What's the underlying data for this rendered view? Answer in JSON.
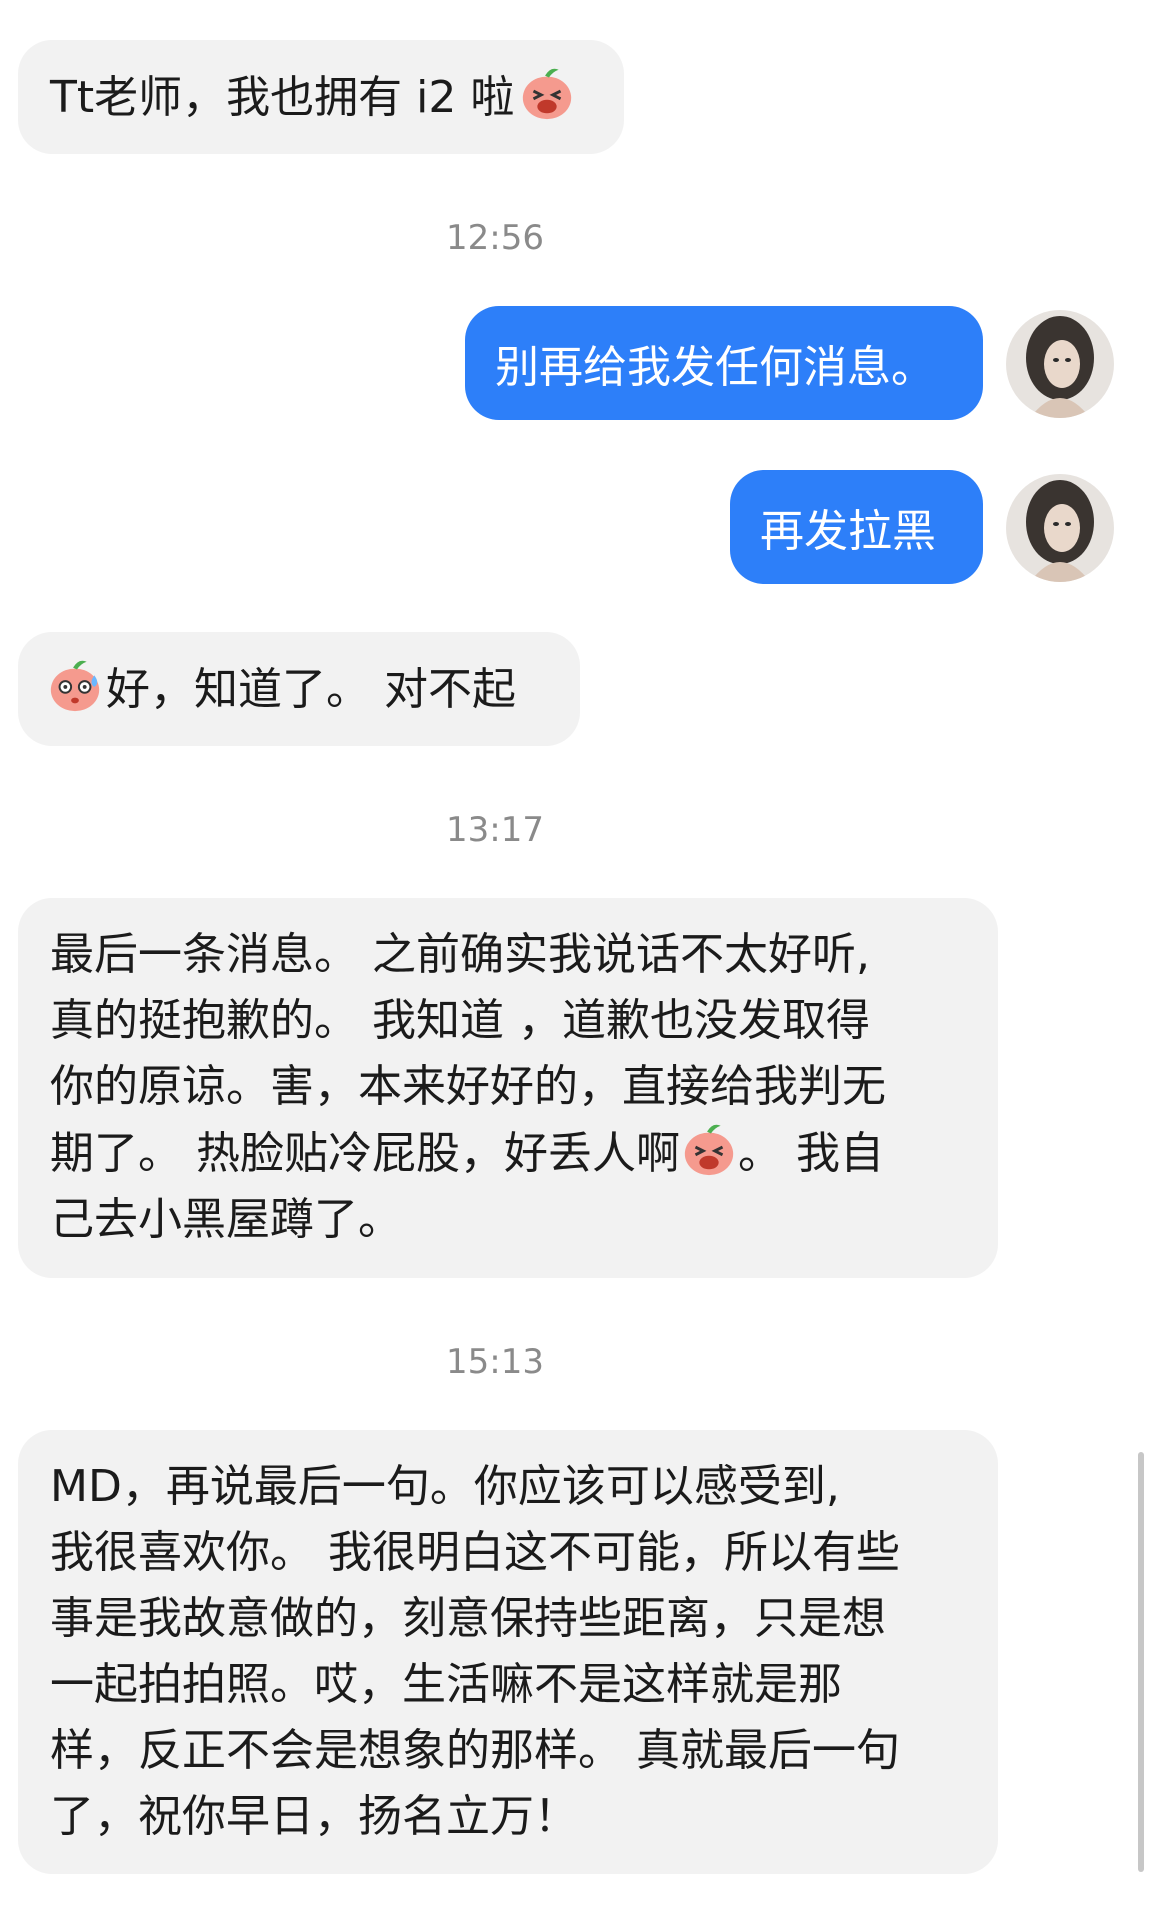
{
  "messages": [
    {
      "type": "in",
      "text": "Tt老师，我也拥有 i2 啦",
      "emoji_after": "grinning-peach-emoji"
    },
    {
      "type": "time",
      "text": "12:56"
    },
    {
      "type": "out",
      "text": "别再给我发任何消息。"
    },
    {
      "type": "out",
      "text": "再发拉黑"
    },
    {
      "type": "in",
      "text": "好，知道了。 对不起",
      "emoji_before": "sweating-peach-emoji"
    },
    {
      "type": "time",
      "text": "13:17"
    },
    {
      "type": "in",
      "lines": [
        "最后一条消息。 之前确实我说话不太好听,",
        "真的挺抱歉的。 我知道 ，道歉也没发取得",
        "你的原谅。害，本来好好的，直接给我判无",
        "期了。 热脸贴冷屁股，好丢人啊",
        "己去小黑屋蹲了。"
      ],
      "line4_tail": "。 我自",
      "emoji_inline": "grinning-peach-emoji"
    },
    {
      "type": "time",
      "text": "15:13"
    },
    {
      "type": "in",
      "lines": [
        "MD，再说最后一句。你应该可以感受到,",
        "我很喜欢你。 我很明白这不可能，所以有些",
        "事是我故意做的，刻意保持些距离，只是想",
        "一起拍拍照。哎，生活嘛不是这样就是那",
        "样，反正不会是想象的那样。 真就最后一句",
        "了，祝你早日，扬名立万！"
      ]
    }
  ],
  "colors": {
    "outgoing_bubble": "#2d7ff9",
    "incoming_bubble": "#f2f2f2",
    "timestamp": "#8a8a8a"
  }
}
